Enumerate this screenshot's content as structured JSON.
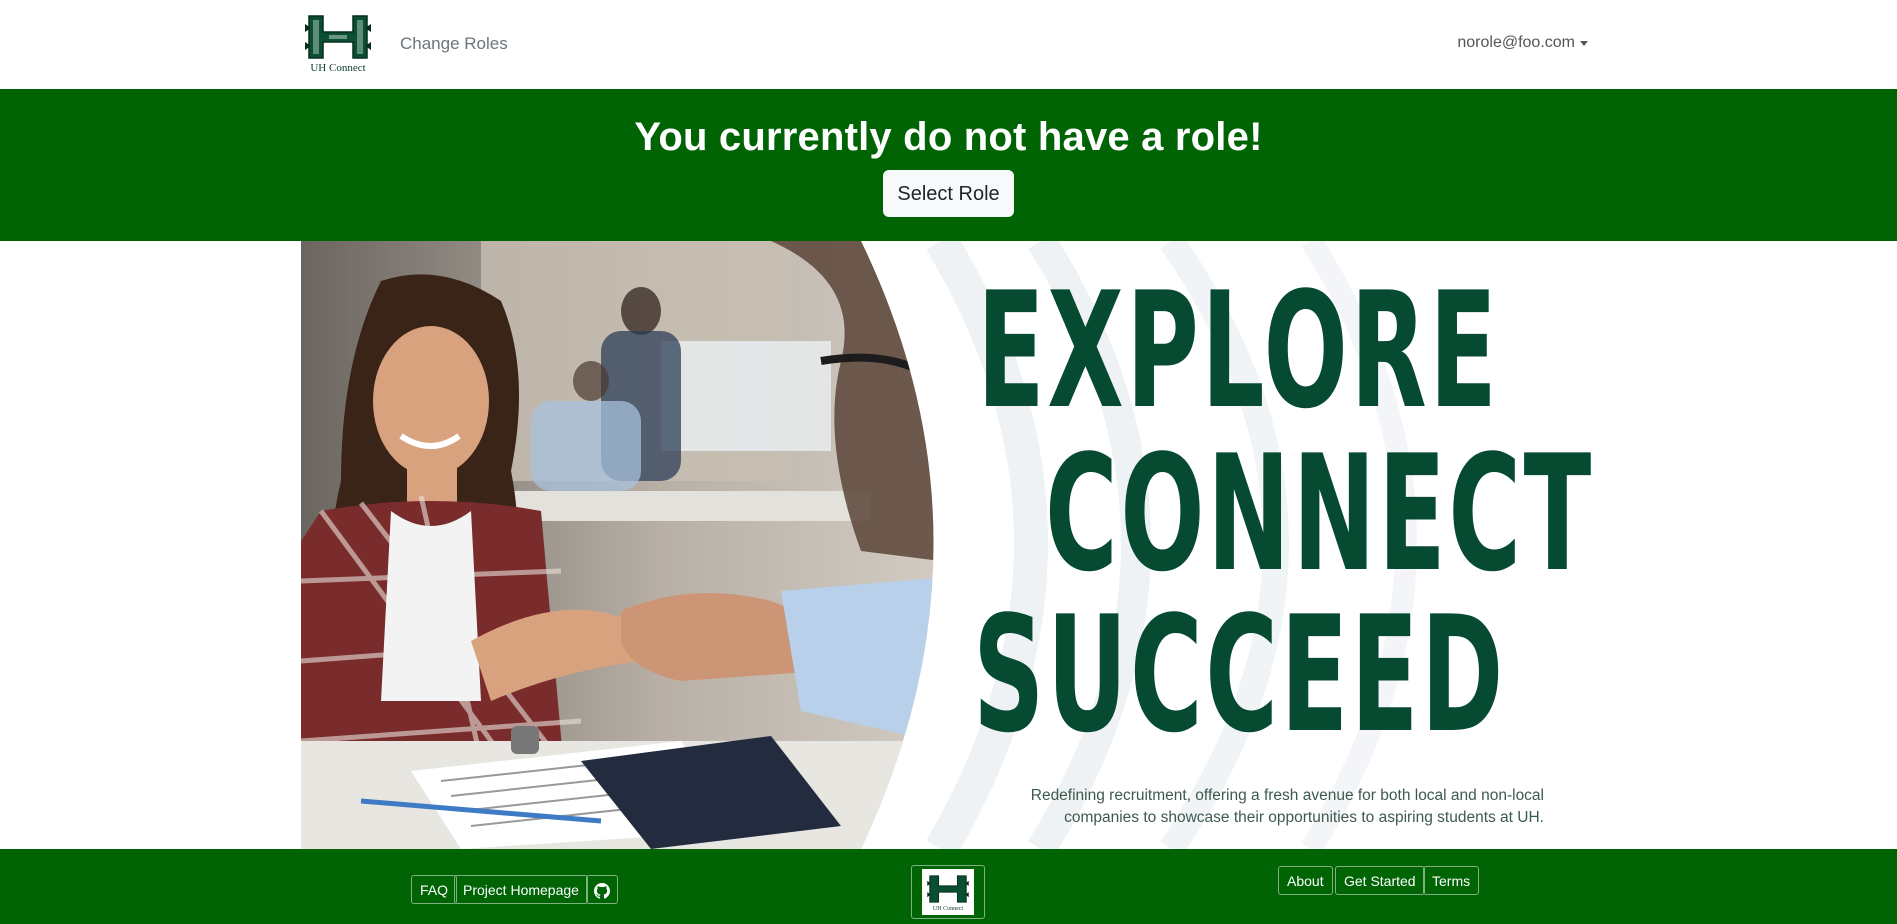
{
  "navbar": {
    "logo_caption": "UH Connect",
    "change_roles_label": "Change Roles",
    "user_email": "norole@foo.com"
  },
  "banner": {
    "title": "You currently do not have a role!",
    "select_role_label": "Select Role"
  },
  "hero": {
    "words": [
      "EXPLORE",
      "CONNECT",
      "SUCCEED"
    ],
    "tagline_line1": "Redefining recruitment, offering a fresh avenue for both local and non-local",
    "tagline_line2": "companies to showcase their opportunities to aspiring students at UH."
  },
  "footer": {
    "left_links": [
      "FAQ",
      "Project Homepage"
    ],
    "right_links": [
      "About",
      "Get Started",
      "Terms"
    ],
    "logo_caption": "UH Connect"
  },
  "colors": {
    "brand_green": "#006405",
    "hero_text": "#064a32",
    "nav_text": "#6c757d"
  },
  "icons": {
    "github": "github-icon",
    "logo": "uh-logo-icon",
    "caret": "caret-down-icon"
  }
}
